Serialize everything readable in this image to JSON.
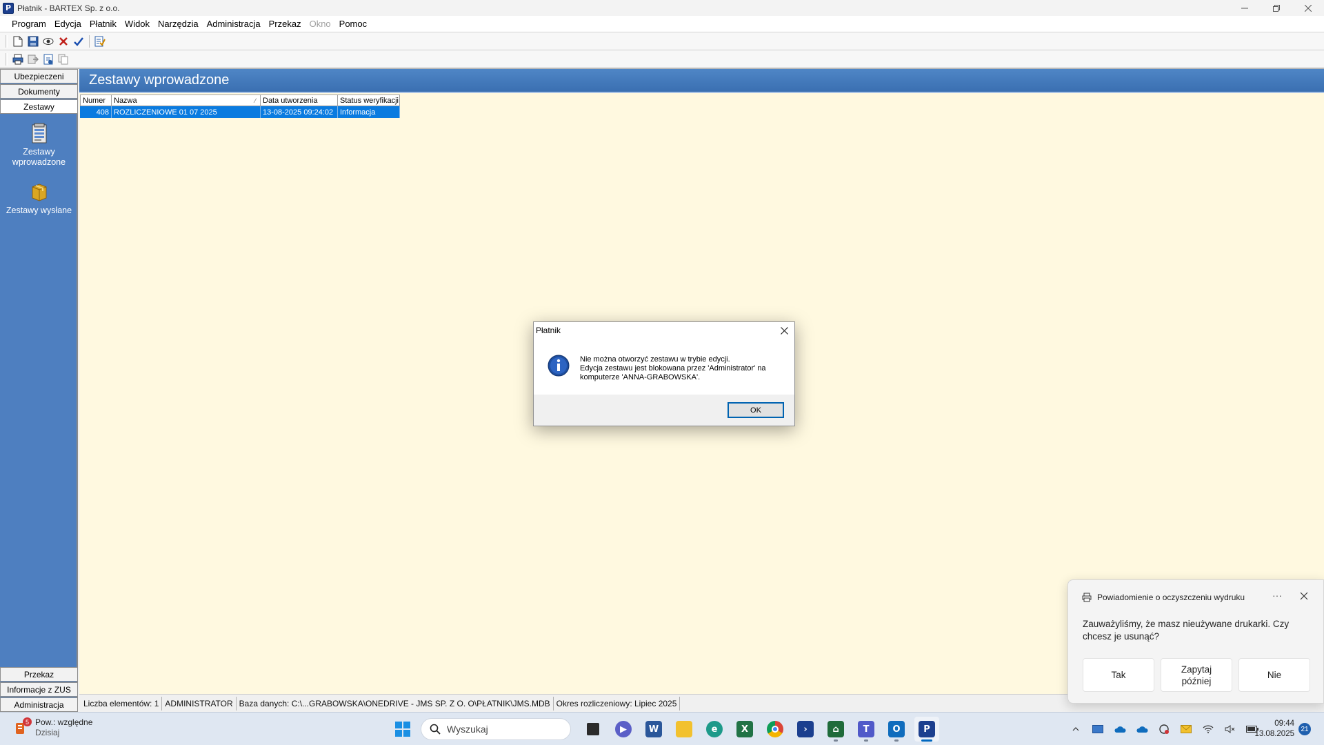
{
  "window": {
    "title": "Płatnik - BARTEX Sp. z o.o.",
    "app_icon_letter": "P"
  },
  "menu": [
    "Program",
    "Edycja",
    "Płatnik",
    "Widok",
    "Narzędzia",
    "Administracja",
    "Przekaz",
    "Okno",
    "Pomoc"
  ],
  "menu_disabled": [
    "Okno"
  ],
  "leftnav": {
    "tabs_top": [
      "Ubezpieczeni",
      "Dokumenty",
      "Zestawy"
    ],
    "active_tab": "Zestawy",
    "items": [
      {
        "label": "Zestawy wprowadzone",
        "icon": "zestawy-wprowadzone-icon"
      },
      {
        "label": "Zestawy wysłane",
        "icon": "zestawy-wyslane-icon"
      }
    ],
    "tabs_bottom": [
      "Przekaz",
      "Informacje z ZUS",
      "Administracja"
    ]
  },
  "content": {
    "title": "Zestawy wprowadzone",
    "columns": [
      "Numer",
      "Nazwa",
      "Data utworzenia",
      "Status weryfikacji"
    ],
    "sort_indicator": "⁄",
    "rows": [
      {
        "numer": "408",
        "nazwa": "ROZLICZENIOWE 01 07 2025",
        "data": "13-08-2025 09:24:02",
        "status": "Informacja"
      }
    ]
  },
  "statusbar": {
    "count": "Liczba elementów: 1",
    "user": "ADMINISTRATOR",
    "db": "Baza danych: C:\\...GRABOWSKA\\ONEDRIVE - JMS SP. Z O. O\\PŁATNIK\\JMS.MDB",
    "period": "Okres rozliczeniowy: Lipiec 2025"
  },
  "dialog": {
    "title": "Płatnik",
    "line1": "Nie można otworzyć zestawu w trybie edycji.",
    "line2": "Edycja zestawu jest blokowana przez 'Administrator' na komputerze 'ANNA-GRABOWSKA'.",
    "ok_label": "OK"
  },
  "toast": {
    "title": "Powiadomienie o oczyszczeniu wydruku",
    "more": "···",
    "message": "Zauważyliśmy, że masz nieużywane drukarki. Czy chcesz je usunąć?",
    "buttons": [
      "Tak",
      "Zapytaj później",
      "Nie"
    ]
  },
  "taskbar": {
    "weather_label": "Pow.: względne",
    "weather_sub": "Dzisiaj",
    "weather_badge": "5",
    "search_placeholder": "Wyszukaj",
    "time": "09:44",
    "date": "13.08.2025",
    "notifications": "21"
  },
  "colors": {
    "content_bg": "#fff9e0",
    "nav_bg": "#4e7fc0",
    "header_bg": "#3a6fb1",
    "selection": "#0a7be0"
  }
}
